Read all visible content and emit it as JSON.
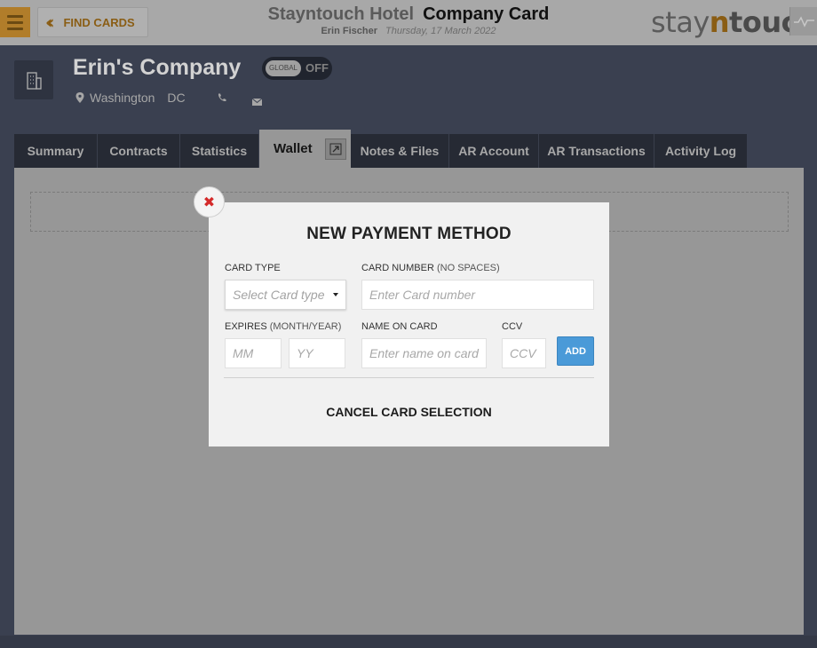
{
  "topbar": {
    "find_cards_label": "FIND CARDS",
    "hotel_name": "Stayntouch Hotel",
    "page_title": "Company Card",
    "user_name": "Erin Fischer",
    "date": "Thursday, 17 March 2022",
    "brand_stay": "stay",
    "brand_n": "n",
    "brand_touch": "touch"
  },
  "company": {
    "name": "Erin's Company",
    "global_label": "GLOBAL",
    "global_state": "OFF",
    "city": "Washington",
    "state": "DC"
  },
  "tabs": [
    {
      "label": "Summary"
    },
    {
      "label": "Contracts"
    },
    {
      "label": "Statistics"
    },
    {
      "label": "Wallet"
    },
    {
      "label": "Notes & Files"
    },
    {
      "label": "AR Account"
    },
    {
      "label": "AR Transactions"
    },
    {
      "label": "Activity Log"
    }
  ],
  "modal": {
    "title": "NEW PAYMENT METHOD",
    "card_type_label": "CARD TYPE",
    "card_type_placeholder": "Select Card type",
    "card_number_label": "CARD NUMBER",
    "card_number_hint": "(NO SPACES)",
    "card_number_placeholder": "Enter Card number",
    "expires_label": "EXPIRES",
    "expires_hint": "(MONTH/YEAR)",
    "mm_placeholder": "MM",
    "yy_placeholder": "YY",
    "name_label": "NAME ON CARD",
    "name_placeholder": "Enter name on card",
    "ccv_label": "CCV",
    "ccv_placeholder": "CCV",
    "add_label": "ADD",
    "cancel_label": "CANCEL CARD SELECTION"
  },
  "colors": {
    "accent": "#b17d2a",
    "add_button": "#4a9ad8",
    "close_x": "#d42a2a",
    "navy": "#3a4050"
  }
}
